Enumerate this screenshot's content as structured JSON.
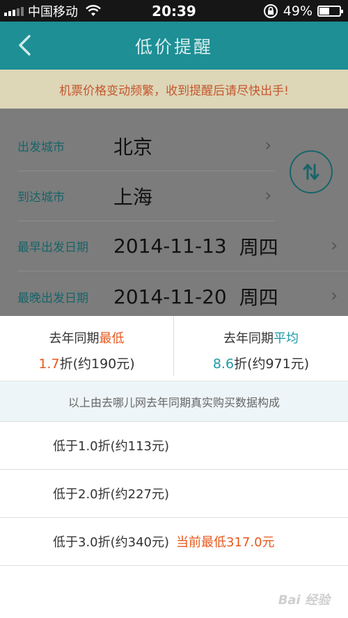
{
  "status_bar": {
    "carrier": "中国移动",
    "time": "20:39",
    "battery": "49%",
    "battery_level": 0.49
  },
  "nav": {
    "title": "低价提醒",
    "back_icon": "chevron-left-icon"
  },
  "notice": "机票价格变动频繁，收到提醒后请尽快出手!",
  "form": {
    "departure_label": "出发城市",
    "departure_value": "北京",
    "arrival_label": "到达城市",
    "arrival_value": "上海",
    "earliest_label": "最早出发日期",
    "earliest_date": "2014-11-13",
    "earliest_weekday": "周四",
    "latest_label": "最晚出发日期",
    "latest_date": "2014-11-20",
    "latest_weekday": "周四",
    "swap_icon": "swap-vertical-icon"
  },
  "stats": {
    "lowest_prefix": "去年同期",
    "lowest_highlight": "最低",
    "lowest_discount": "1.7",
    "lowest_suffix": "折(约190元)",
    "average_prefix": "去年同期",
    "average_highlight": "平均",
    "average_discount": "8.6",
    "average_suffix": "折(约971元)"
  },
  "source_note": "以上由去哪儿网去年同期真实购买数据构成",
  "options": [
    {
      "label": "低于1.0折(约113元)"
    },
    {
      "label": "低于2.0折(约227元)"
    },
    {
      "label": "低于3.0折(约340元)",
      "current": "当前最低317.0元"
    }
  ],
  "watermark": "Bai 经验",
  "colors": {
    "nav": "#1d8f95",
    "accent_orange": "#e8581d",
    "accent_teal": "#1e9aa6"
  }
}
